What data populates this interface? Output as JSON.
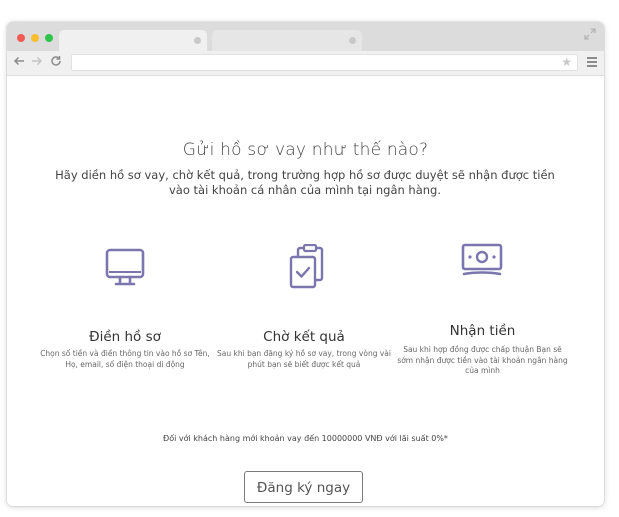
{
  "colors": {
    "accent_icon": "#7b76ad",
    "titlebar": "#dcdcdc",
    "toolbar": "#f0f0f0"
  },
  "browser": {
    "icons": {
      "back": "arrow-left-icon",
      "forward": "arrow-right-icon",
      "reload": "reload-icon",
      "bookmark": "star-icon",
      "menu": "hamburger-menu-icon",
      "expand": "expand-icon"
    }
  },
  "main": {
    "title": "Gửi hồ sơ vay như thế nào?",
    "subtitle": "Hãy diền hồ sơ vay, chờ kết quả, trong trường hợp hồ sơ được duyệt sẽ nhận được tiền vào tài khoản cá nhân của mình tại ngân hàng.",
    "features": [
      {
        "icon": "monitor-icon",
        "title": "Điền hồ sơ",
        "description": "Chọn số tiền và điền thông tin vào hồ sơ Tên, Họ, email, số điện thoại di động"
      },
      {
        "icon": "clipboard-check-icon",
        "title": "Chờ kết quả",
        "description": "Sau khi bạn đăng ký hồ sơ vay, trong vòng vài phút bạn sẽ biết được kết quả"
      },
      {
        "icon": "money-icon",
        "title": "Nhận tiền",
        "description": "Sau khi hợp đồng được chấp thuận Bạn sẽ sớm nhận được tiền vào tài khoản ngân hàng của mình"
      }
    ],
    "promo": "Đối với khách hàng mới khoản vay đến 10000000 VNĐ với lãi suất 0%*",
    "cta_label": "Đăng ký ngay"
  }
}
